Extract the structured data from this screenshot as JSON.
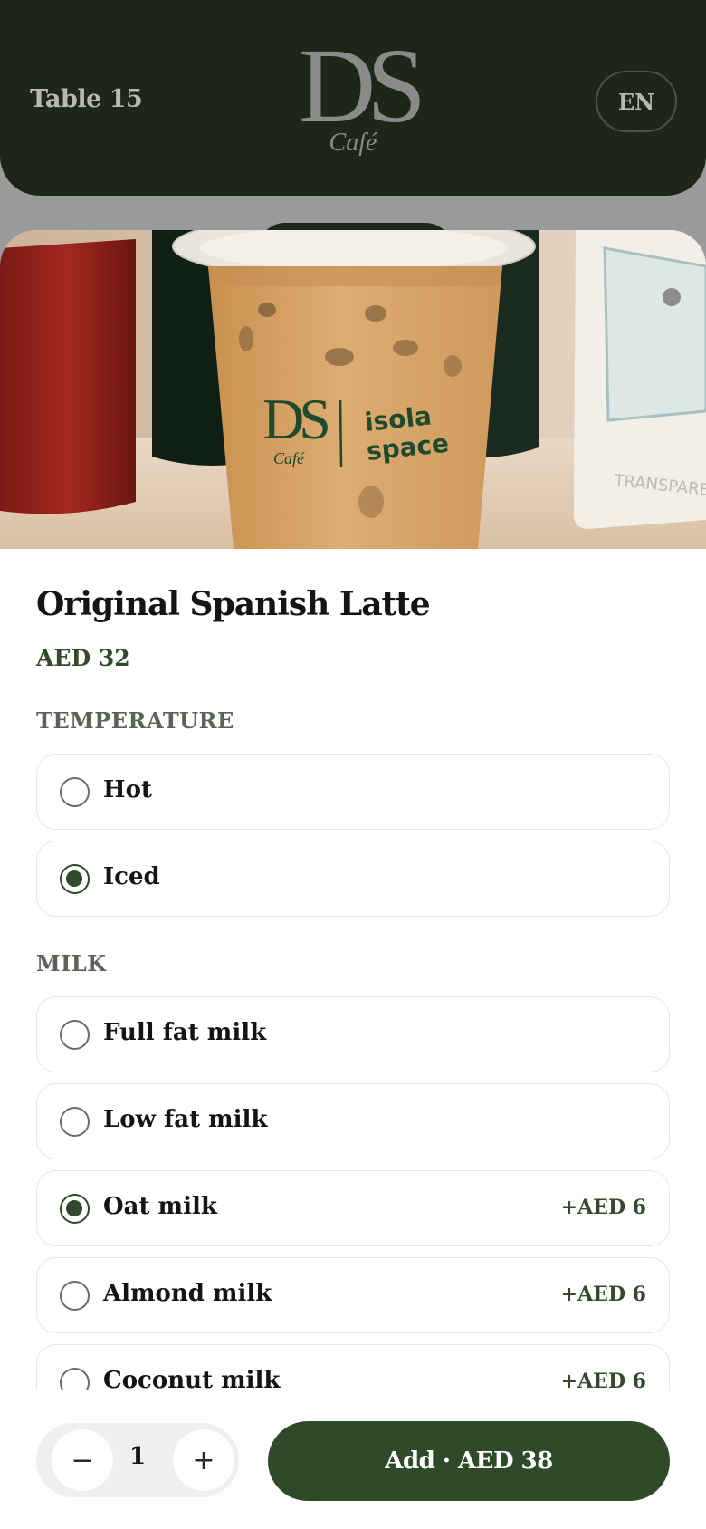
{
  "header": {
    "table_label": "Table 15",
    "logo_mark": "DS",
    "logo_sub": "Café",
    "language": "EN"
  },
  "product": {
    "image_cup_brand": "DS",
    "image_cup_sub": "Café",
    "image_cup_partner": [
      "isola",
      "space"
    ],
    "image_box_text": "TRANSPARE",
    "name": "Original Spanish Latte",
    "price": "AED 32"
  },
  "sections": {
    "temperature": {
      "label": "TEMPERATURE",
      "options": [
        {
          "label": "Hot",
          "selected": false
        },
        {
          "label": "Iced",
          "selected": true
        }
      ]
    },
    "milk": {
      "label": "MILK",
      "options": [
        {
          "label": "Full fat milk",
          "selected": false,
          "extra": ""
        },
        {
          "label": "Low fat milk",
          "selected": false,
          "extra": ""
        },
        {
          "label": "Oat milk",
          "selected": true,
          "extra": "+AED 6"
        },
        {
          "label": "Almond milk",
          "selected": false,
          "extra": "+AED 6"
        },
        {
          "label": "Coconut milk",
          "selected": false,
          "extra": "+AED 6"
        }
      ]
    }
  },
  "footer": {
    "minus_symbol": "−",
    "quantity": "1",
    "plus_symbol": "+",
    "add_label": "Add · AED 38"
  },
  "colors": {
    "header_bg": "#1e2618",
    "accent": "#2f4a28",
    "price_green": "#334a2c"
  },
  "icons": [
    "minus-icon",
    "plus-icon",
    "radio-icon"
  ]
}
